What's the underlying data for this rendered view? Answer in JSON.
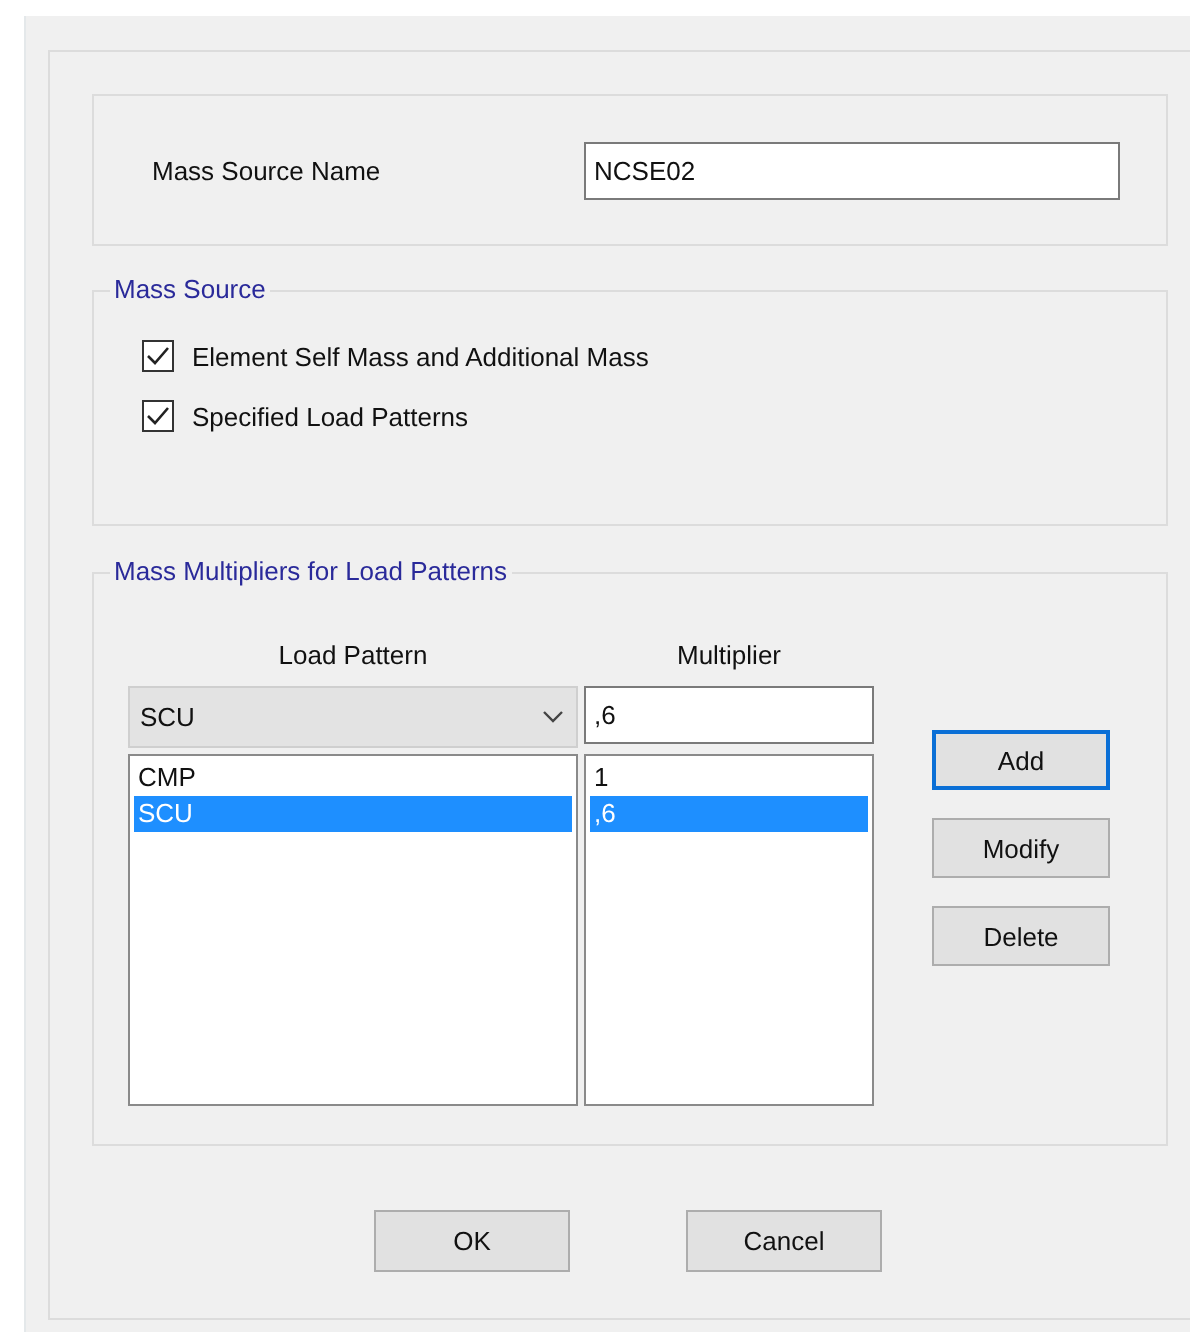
{
  "name_field": {
    "label": "Mass Source Name",
    "value": "NCSE02"
  },
  "mass_source": {
    "title": "Mass Source",
    "options": [
      {
        "label": "Element Self Mass and Additional Mass",
        "checked": true
      },
      {
        "label": "Specified Load Patterns",
        "checked": true
      }
    ]
  },
  "multipliers": {
    "title": "Mass Multipliers for Load Patterns",
    "columns": [
      "Load Pattern",
      "Multiplier"
    ],
    "pattern_dropdown": {
      "value": "SCU"
    },
    "multiplier_field": {
      "value": ",6"
    },
    "rows": [
      {
        "load_pattern": "CMP",
        "multiplier": "1",
        "selected": false
      },
      {
        "load_pattern": "SCU",
        "multiplier": ",6",
        "selected": true
      }
    ],
    "buttons": [
      {
        "label": "Add",
        "focused": true
      },
      {
        "label": "Modify",
        "focused": false
      },
      {
        "label": "Delete",
        "focused": false
      }
    ]
  },
  "buttons": [
    {
      "label": "OK",
      "focused": false
    },
    {
      "label": "Cancel",
      "focused": false
    }
  ]
}
